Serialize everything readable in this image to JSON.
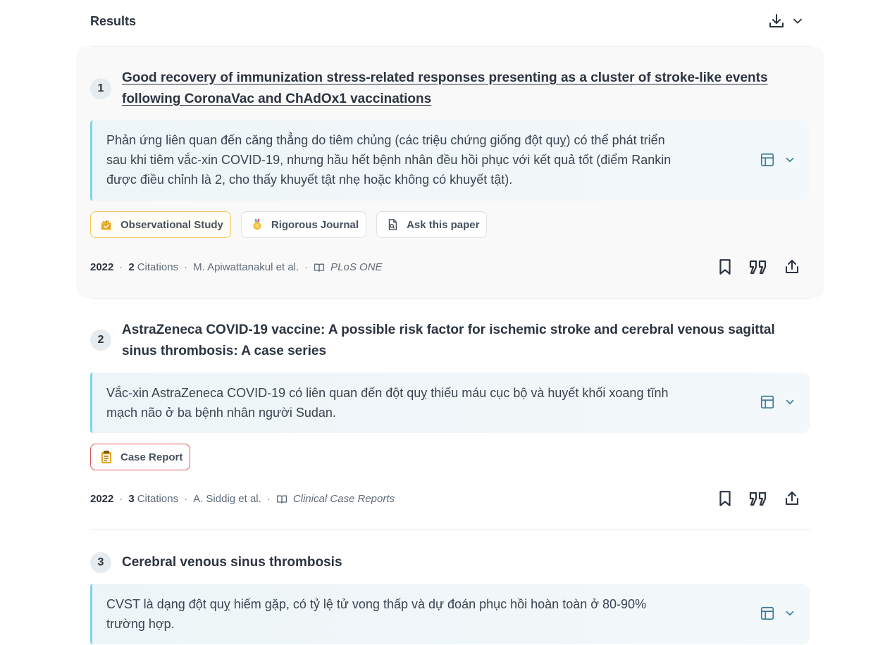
{
  "header": {
    "title": "Results",
    "download_icon": "download-icon",
    "chevron_icon": "chevron-down-icon"
  },
  "results": [
    {
      "rank": "1",
      "title_lines": [
        "Good recovery of immunization stress-related responses presenting as a cluster of stroke-like events",
        "following CoronaVac and ChAdOx1 vaccinations"
      ],
      "summary_lines": [
        "Phản ứng liên quan đến căng thẳng do tiêm chủng (các triệu chứng giống đột quỵ) có thể phát triển",
        "sau khi tiêm vắc-xin COVID-19, nhưng hầu hết bệnh nhân đều hồi phục với kết quả tốt (điểm Rankin",
        "được điều chỉnh là 2, cho thấy khuyết tật nhẹ hoặc không có khuyết tật)."
      ],
      "badges": [
        "Observational Study",
        "Rigorous Journal",
        "Ask this paper"
      ],
      "year": "2022",
      "citations_count": "2",
      "citations_label": "Citations",
      "authors": "M. Apiwattanakul et al.",
      "journal": "PLoS ONE"
    },
    {
      "rank": "2",
      "title_lines": [
        "AstraZeneca COVID-19 vaccine: A possible risk factor for ischemic stroke and cerebral venous sagittal",
        "sinus thrombosis: A case series"
      ],
      "summary_lines": [
        "Vắc-xin AstraZeneca COVID-19 có liên quan đến đột quỵ thiếu máu cục bộ và huyết khối xoang tĩnh",
        "mạch não ở ba bệnh nhân người Sudan."
      ],
      "badges": [
        "Case Report"
      ],
      "year": "2022",
      "citations_count": "3",
      "citations_label": "Citations",
      "authors": "A. Siddig et al.",
      "journal": "Clinical Case Reports"
    },
    {
      "rank": "3",
      "title_lines": [
        "Cerebral venous sinus thrombosis"
      ],
      "summary_lines": [
        "CVST là dạng đột quỵ hiếm gặp, có tỷ lệ tử vong thấp và dự đoán phục hồi hoàn toàn ở 80-90%",
        "trường hợp."
      ]
    }
  ],
  "colors": {
    "accent_bar": "#7fd3ea",
    "observational_border": "#f0c659",
    "case_report_border": "#e05a5a",
    "rank_bg": "#e6ebef"
  },
  "icons": {
    "table": "table-icon",
    "expand": "chevron-down-icon",
    "bookmark": "bookmark-icon",
    "cite": "quote-icon",
    "share": "share-icon",
    "journal": "book-icon"
  }
}
